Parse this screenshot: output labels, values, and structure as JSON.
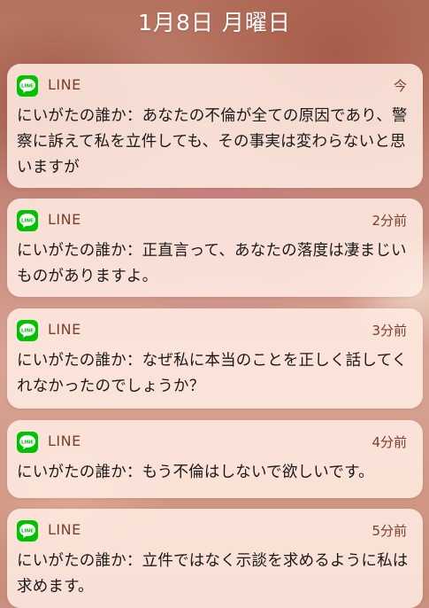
{
  "lockscreen": {
    "date": "1月8日 月曜日"
  },
  "notifications": [
    {
      "app": "LINE",
      "time": "今",
      "message": "にいがたの誰か：あなたの不倫が全ての原因であり、警察に訴えて私を立件しても、その事実は変わらないと思いますが"
    },
    {
      "app": "LINE",
      "time": "2分前",
      "message": "にいがたの誰か：正直言って、あなたの落度は凄まじいものがありますよ。"
    },
    {
      "app": "LINE",
      "time": "3分前",
      "message": "にいがたの誰か：なぜ私に本当のことを正しく話してくれなかったのでしょうか？"
    },
    {
      "app": "LINE",
      "time": "4分前",
      "message": "にいがたの誰か：もう不倫はしないで欲しいです。"
    },
    {
      "app": "LINE",
      "time": "5分前",
      "message": "にいがたの誰か：立件ではなく示談を求めるように私は求めます。"
    }
  ],
  "colors": {
    "line_green": "#00c300",
    "card_bg": "#ffece2",
    "app_name_color": "#7a3e2a"
  },
  "icons": {
    "app_icon": "line-app-icon"
  }
}
